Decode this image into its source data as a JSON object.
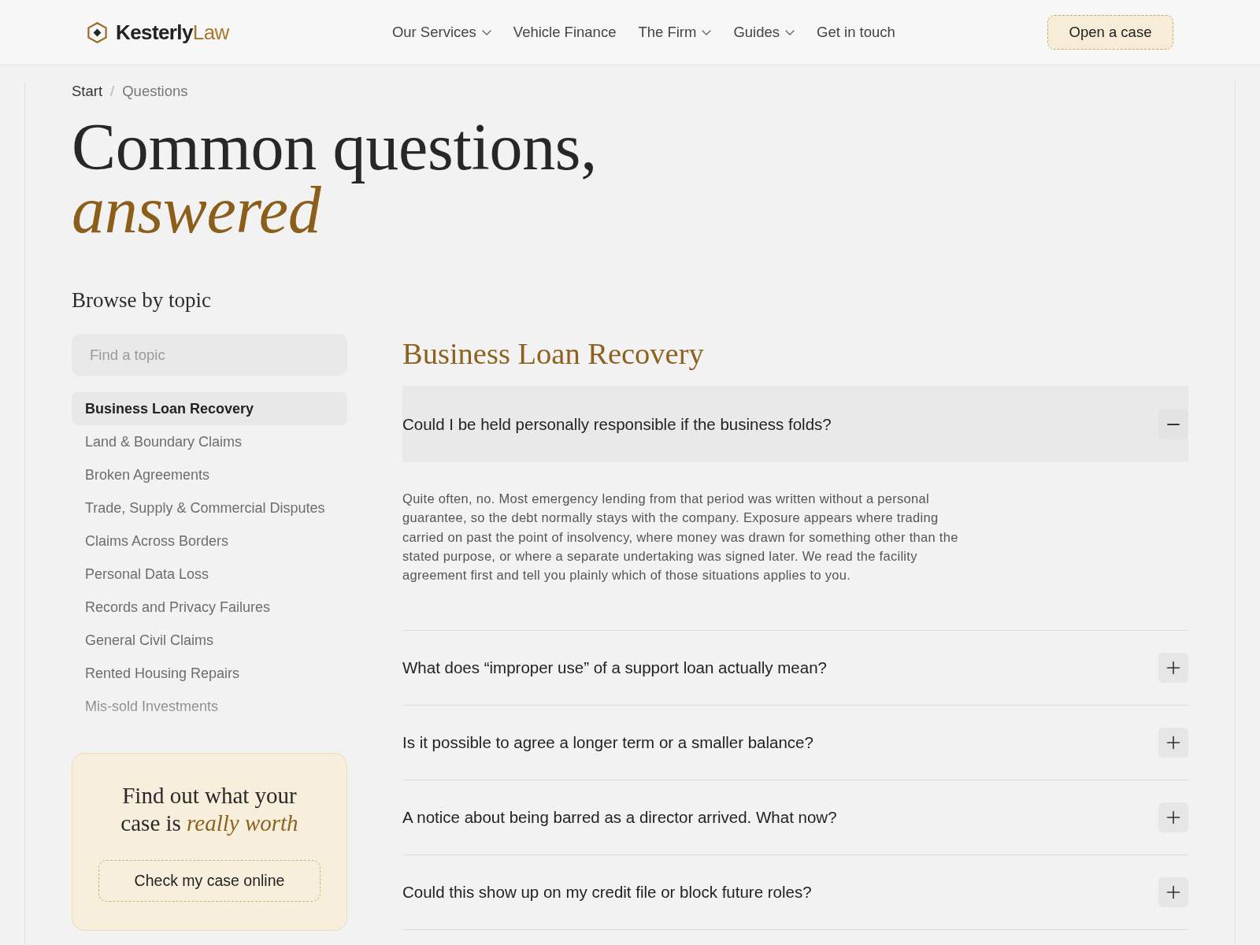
{
  "header": {
    "brand": "**Kesterly**Law",
    "nav": [
      {
        "label": "Our Services",
        "dropdown": true
      },
      {
        "label": "Vehicle Finance",
        "dropdown": false
      },
      {
        "label": "The Firm",
        "dropdown": true
      },
      {
        "label": "Guides",
        "dropdown": true
      },
      {
        "label": "Get in touch",
        "dropdown": false
      }
    ],
    "cta": "Open a case"
  },
  "breadcrumb": {
    "items": [
      {
        "label": "Start",
        "current": false
      },
      {
        "label": "Questions",
        "current": true
      }
    ],
    "separator": "/"
  },
  "page_title": "Common questions, *answered*",
  "sidebar": {
    "heading": "Browse by topic",
    "search": {
      "placeholder": "Find a topic"
    },
    "topics": [
      {
        "label": "Business Loan Recovery",
        "selected": true
      },
      {
        "label": "Land & Boundary Claims",
        "selected": false
      },
      {
        "label": "Broken Agreements",
        "selected": false
      },
      {
        "label": "Trade, Supply & Commercial Disputes",
        "selected": false
      },
      {
        "label": "Claims Across Borders",
        "selected": false
      },
      {
        "label": "Personal Data Loss",
        "selected": false
      },
      {
        "label": "Records and Privacy Failures",
        "selected": false
      },
      {
        "label": "General Civil Claims",
        "selected": false
      },
      {
        "label": "Rented Housing Repairs",
        "selected": false
      },
      {
        "label": "Mis-sold Investments",
        "selected": false
      }
    ]
  },
  "promo": {
    "heading": "Find out what your case is *really worth*",
    "button": "Check my case online"
  },
  "faq": {
    "heading": "Business Loan Recovery",
    "items": [
      {
        "question": "Could I be held personally responsible if the business folds?",
        "expanded": true,
        "answer": "Quite often, no. Most emergency lending from that period was written without a personal guarantee, so the debt normally stays with the company. Exposure appears where trading carried on past the point of insolvency, where money was drawn for something other than the stated purpose, or where a separate undertaking was signed later. We read the facility agreement first and tell you plainly which of those situations applies to you."
      },
      {
        "question": "What does “improper use” of a support loan actually mean?",
        "expanded": false
      },
      {
        "question": "Is it possible to agree a longer term or a smaller balance?",
        "expanded": false
      },
      {
        "question": "A notice about being barred as a director arrived. What now?",
        "expanded": false
      },
      {
        "question": "Could this show up on my credit file or block future roles?",
        "expanded": false
      }
    ]
  }
}
